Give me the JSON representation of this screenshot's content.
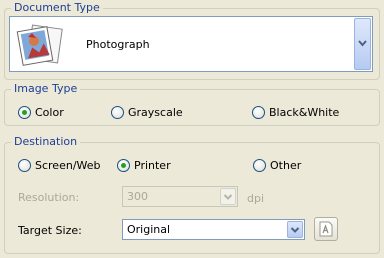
{
  "document_type": {
    "legend": "Document Type",
    "selected": "Photograph"
  },
  "image_type": {
    "legend": "Image Type",
    "options": [
      "Color",
      "Grayscale",
      "Black&White"
    ],
    "selected": "Color"
  },
  "destination": {
    "legend": "Destination",
    "options": [
      "Screen/Web",
      "Printer",
      "Other"
    ],
    "selected": "Printer",
    "resolution_label": "Resolution:",
    "resolution_value": "300",
    "resolution_unit": "dpi",
    "target_size_label": "Target Size:",
    "target_size_value": "Original"
  },
  "icons": {
    "doc_thumbnail": "photograph-icon",
    "combo_arrow": "chevron-down-icon",
    "scale_tool": "scale-size-icon"
  }
}
